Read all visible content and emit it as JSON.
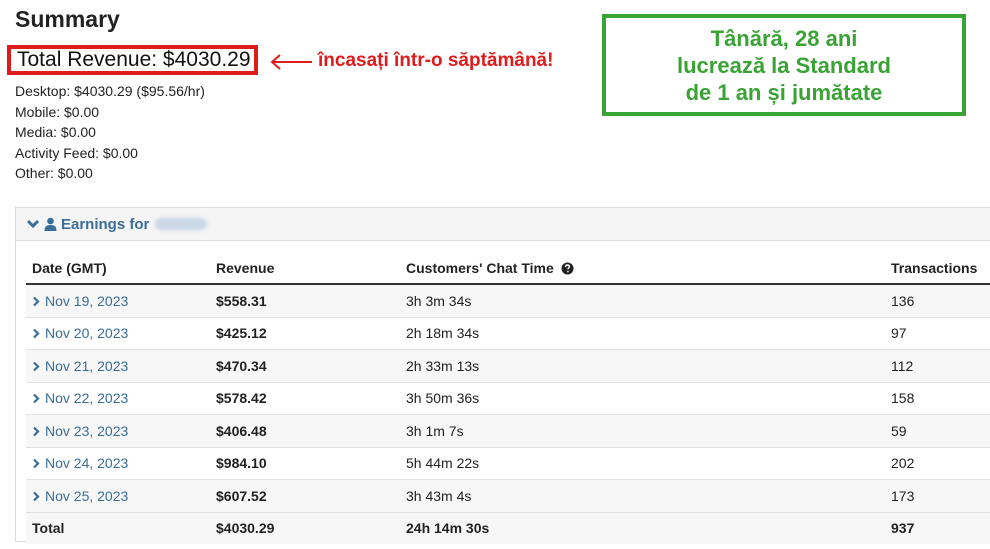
{
  "summary": {
    "title": "Summary",
    "total_revenue": "Total Revenue: $4030.29",
    "breakdown": [
      "Desktop: $4030.29 ($95.56/hr)",
      "Mobile: $0.00",
      "Media: $0.00",
      "Activity Feed: $0.00",
      "Other: $0.00"
    ]
  },
  "annotations": {
    "red_note": "încasați într-o săptămână!",
    "green_lines": [
      "Tânără, 28 ani",
      "lucrează la Standard",
      "de 1 an și jumătate"
    ],
    "red_color": "#e01b1b",
    "green_color": "#3aa335"
  },
  "earnings": {
    "header_label": "Earnings for",
    "columns": [
      "Date (GMT)",
      "Revenue",
      "Customers' Chat Time",
      "Transactions"
    ],
    "rows": [
      {
        "date": "Nov 19, 2023",
        "revenue": "$558.31",
        "chat_time": "3h 3m 34s",
        "transactions": "136"
      },
      {
        "date": "Nov 20, 2023",
        "revenue": "$425.12",
        "chat_time": "2h 18m 34s",
        "transactions": "97"
      },
      {
        "date": "Nov 21, 2023",
        "revenue": "$470.34",
        "chat_time": "2h 33m 13s",
        "transactions": "112"
      },
      {
        "date": "Nov 22, 2023",
        "revenue": "$578.42",
        "chat_time": "3h 50m 36s",
        "transactions": "158"
      },
      {
        "date": "Nov 23, 2023",
        "revenue": "$406.48",
        "chat_time": "3h 1m 7s",
        "transactions": "59"
      },
      {
        "date": "Nov 24, 2023",
        "revenue": "$984.10",
        "chat_time": "5h 44m 22s",
        "transactions": "202"
      },
      {
        "date": "Nov 25, 2023",
        "revenue": "$607.52",
        "chat_time": "3h 43m 4s",
        "transactions": "173"
      }
    ],
    "total": {
      "label": "Total",
      "revenue": "$4030.29",
      "chat_time": "24h 14m 30s",
      "transactions": "937"
    },
    "icons": {
      "collapse": "chevron-down-icon",
      "user": "user-icon",
      "row_expand": "chevron-right-icon",
      "help": "question-circle-icon"
    },
    "link_color": "#3a6d99"
  }
}
